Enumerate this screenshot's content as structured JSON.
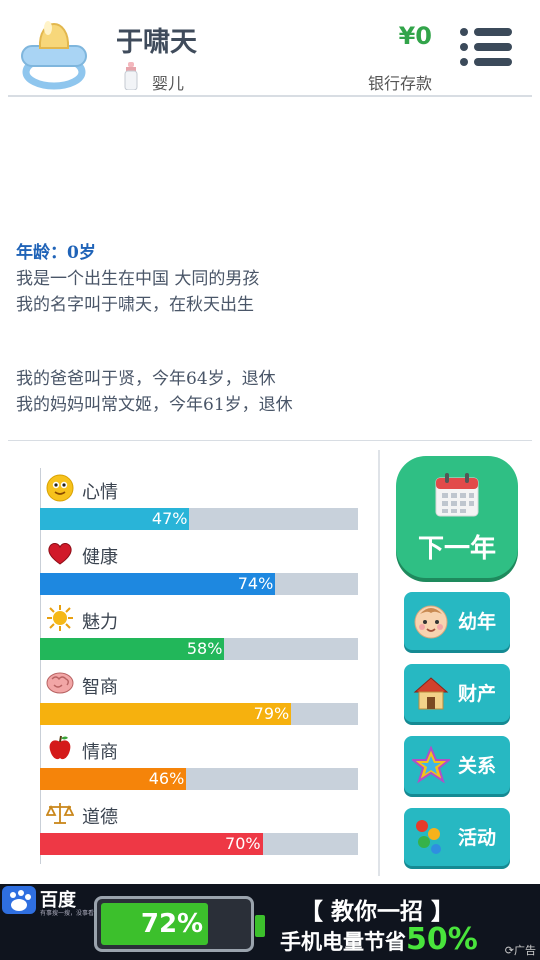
{
  "header": {
    "name": "于啸天",
    "stage": "婴儿",
    "money": "¥0",
    "bank_label": "银行存款"
  },
  "story": {
    "age_line": "年龄：0岁",
    "lines": [
      "我是一个出生在中国 大同的男孩",
      "我的名字叫于啸天，在秋天出生"
    ],
    "parents": [
      "我的爸爸叫于贤，今年64岁，退休",
      "我的妈妈叫常文姬，今年61岁，退休"
    ]
  },
  "stats": [
    {
      "label": "心情",
      "value": 47,
      "pct": "47%",
      "color": "#29b4d8",
      "icon": "smiley-icon"
    },
    {
      "label": "健康",
      "value": 74,
      "pct": "74%",
      "color": "#1e88e0",
      "icon": "heart-icon"
    },
    {
      "label": "魅力",
      "value": 58,
      "pct": "58%",
      "color": "#22b75a",
      "icon": "sun-icon"
    },
    {
      "label": "智商",
      "value": 79,
      "pct": "79%",
      "color": "#f6b10e",
      "icon": "brain-icon"
    },
    {
      "label": "情商",
      "value": 46,
      "pct": "46%",
      "color": "#f5840a",
      "icon": "apple-icon"
    },
    {
      "label": "道德",
      "value": 70,
      "pct": "70%",
      "color": "#ee3845",
      "icon": "scales-icon"
    }
  ],
  "buttons": {
    "next_year": "下一年",
    "childhood": "幼年",
    "property": "财产",
    "relations": "关系",
    "activity": "活动"
  },
  "ad": {
    "brand": "百度",
    "tagline": "有事搜一搜，没事看一看",
    "battery_pct": "72%",
    "battery_level": 72,
    "headline": "【 教你一招 】",
    "sub_prefix": "手机电量节省",
    "sub_highlight": "50%",
    "ad_tag": "广告"
  }
}
